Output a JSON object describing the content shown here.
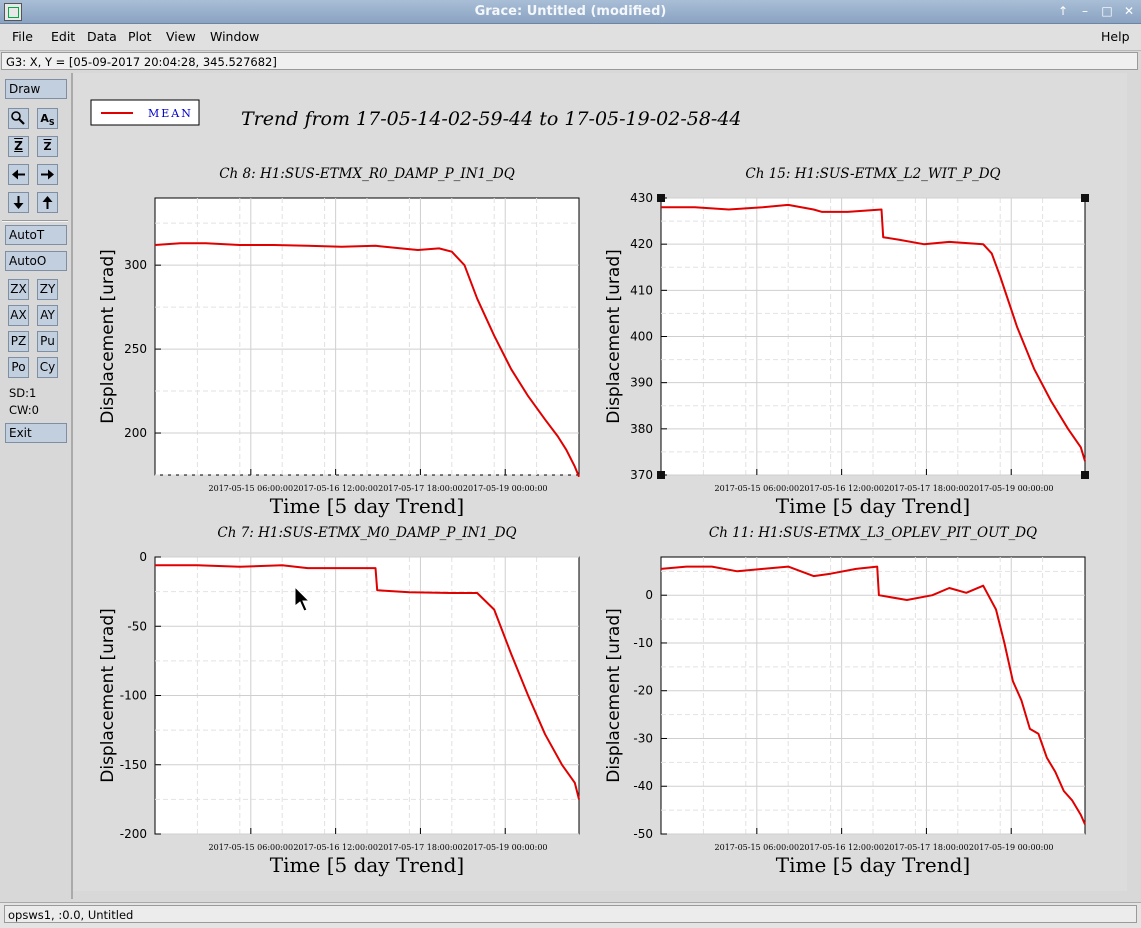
{
  "window": {
    "title": "Grace: Untitled (modified)",
    "controls": [
      "↑",
      "–",
      "□",
      "✕"
    ]
  },
  "menu": {
    "file": "File",
    "edit": "Edit",
    "data": "Data",
    "plot": "Plot",
    "view": "View",
    "window": "Window",
    "help": "Help"
  },
  "locator": {
    "text": "G3: X, Y = [05-09-2017 20:04:28, 345.527682]"
  },
  "tools": {
    "draw": "Draw",
    "autot": "AutoT",
    "autoo": "AutoO",
    "zx": "ZX",
    "zy": "ZY",
    "ax": "AX",
    "ay": "AY",
    "pz": "PZ",
    "pu": "Pu",
    "po": "Po",
    "cy": "Cy",
    "sd": "SD:1",
    "cw": "CW:0",
    "exit": "Exit"
  },
  "plot": {
    "title": "Trend from 17-05-14-02-59-44 to 17-05-19-02-58-44",
    "legend": "MEAN",
    "line_color": "#e00000"
  },
  "status": {
    "text": "opsws1, :0.0, Untitled"
  },
  "chart_data": [
    {
      "type": "line",
      "title": "Ch 8: H1:SUS-ETMX_R0_DAMP_P_IN1_DQ",
      "xlabel": "Time [5 day Trend]",
      "ylabel": "Displacement [urad]",
      "xlim": [
        0,
        5
      ],
      "ylim": [
        175,
        340
      ],
      "yticks": [
        200,
        250,
        300
      ],
      "xtick_pos": [
        1.13,
        2.13,
        3.13,
        4.13
      ],
      "xticks": [
        "2017-05-15 06:00:00",
        "2017-05-16 12:00:00",
        "2017-05-17 18:00:00",
        "2017-05-19 00:00:00"
      ],
      "series": [
        {
          "name": "MEAN",
          "x": [
            0,
            0.3,
            0.6,
            1.0,
            1.4,
            1.8,
            2.2,
            2.6,
            2.9,
            3.1,
            3.35,
            3.5,
            3.65,
            3.8,
            4.0,
            4.2,
            4.4,
            4.6,
            4.75,
            4.85,
            4.95,
            5.0
          ],
          "y": [
            312,
            313,
            313,
            312,
            312,
            311.5,
            311,
            311.5,
            310,
            309,
            310,
            308,
            300,
            280,
            258,
            238,
            222,
            208,
            198,
            190,
            180,
            174
          ]
        }
      ]
    },
    {
      "type": "line",
      "title": "Ch 15: H1:SUS-ETMX_L2_WIT_P_DQ",
      "xlabel": "Time [5 day Trend]",
      "ylabel": "Displacement [urad]",
      "xlim": [
        0,
        5
      ],
      "ylim": [
        370,
        430
      ],
      "yticks": [
        370,
        380,
        390,
        400,
        410,
        420,
        430
      ],
      "xtick_pos": [
        1.13,
        2.13,
        3.13,
        4.13
      ],
      "xticks": [
        "2017-05-15 06:00:00",
        "2017-05-16 12:00:00",
        "2017-05-17 18:00:00",
        "2017-05-19 00:00:00"
      ],
      "series": [
        {
          "name": "MEAN",
          "x": [
            0,
            0.4,
            0.8,
            1.2,
            1.5,
            1.8,
            1.9,
            2.2,
            2.6,
            2.62,
            2.8,
            3.1,
            3.4,
            3.8,
            3.9,
            4.0,
            4.2,
            4.4,
            4.6,
            4.8,
            4.95,
            5.0
          ],
          "y": [
            428,
            428,
            427.5,
            428,
            428.5,
            427.5,
            427,
            427,
            427.5,
            421.5,
            421,
            420,
            420.5,
            420,
            418,
            413,
            402,
            393,
            386,
            380,
            376,
            373
          ]
        }
      ]
    },
    {
      "type": "line",
      "title": "Ch 7: H1:SUS-ETMX_M0_DAMP_P_IN1_DQ",
      "xlabel": "Time [5 day Trend]",
      "ylabel": "Displacement [urad]",
      "xlim": [
        0,
        5
      ],
      "ylim": [
        -200,
        0
      ],
      "yticks": [
        -200,
        -150,
        -100,
        -50,
        0
      ],
      "xtick_pos": [
        1.13,
        2.13,
        3.13,
        4.13
      ],
      "xticks": [
        "2017-05-15 06:00:00",
        "2017-05-16 12:00:00",
        "2017-05-17 18:00:00",
        "2017-05-19 00:00:00"
      ],
      "series": [
        {
          "name": "MEAN",
          "x": [
            0,
            0.5,
            1.0,
            1.5,
            1.8,
            2.1,
            2.6,
            2.62,
            3.0,
            3.5,
            3.8,
            4.0,
            4.2,
            4.4,
            4.6,
            4.8,
            4.95,
            5.0
          ],
          "y": [
            -6,
            -6,
            -7,
            -6,
            -8,
            -8,
            -8,
            -24,
            -25.5,
            -26,
            -26,
            -38,
            -70,
            -100,
            -128,
            -150,
            -163,
            -175
          ]
        }
      ]
    },
    {
      "type": "line",
      "title": "Ch 11: H1:SUS-ETMX_L3_OPLEV_PIT_OUT_DQ",
      "xlabel": "Time [5 day Trend]",
      "ylabel": "Displacement [urad]",
      "xlim": [
        0,
        5
      ],
      "ylim": [
        -50,
        8
      ],
      "yticks": [
        -50,
        -40,
        -30,
        -20,
        -10,
        0
      ],
      "xtick_pos": [
        1.13,
        2.13,
        3.13,
        4.13
      ],
      "xticks": [
        "2017-05-15 06:00:00",
        "2017-05-16 12:00:00",
        "2017-05-17 18:00:00",
        "2017-05-19 00:00:00"
      ],
      "series": [
        {
          "name": "MEAN",
          "x": [
            0,
            0.3,
            0.6,
            0.9,
            1.2,
            1.5,
            1.8,
            2.0,
            2.3,
            2.55,
            2.57,
            2.9,
            3.2,
            3.4,
            3.6,
            3.8,
            3.95,
            4.05,
            4.15,
            4.25,
            4.35,
            4.45,
            4.55,
            4.65,
            4.75,
            4.85,
            4.95,
            5.0
          ],
          "y": [
            5.5,
            6,
            6,
            5,
            5.5,
            6,
            4,
            4.5,
            5.5,
            6,
            0,
            -1,
            0,
            1.5,
            0.5,
            2,
            -3,
            -10,
            -18,
            -22,
            -28,
            -29,
            -34,
            -37,
            -41,
            -43,
            -46,
            -48
          ]
        }
      ]
    }
  ]
}
